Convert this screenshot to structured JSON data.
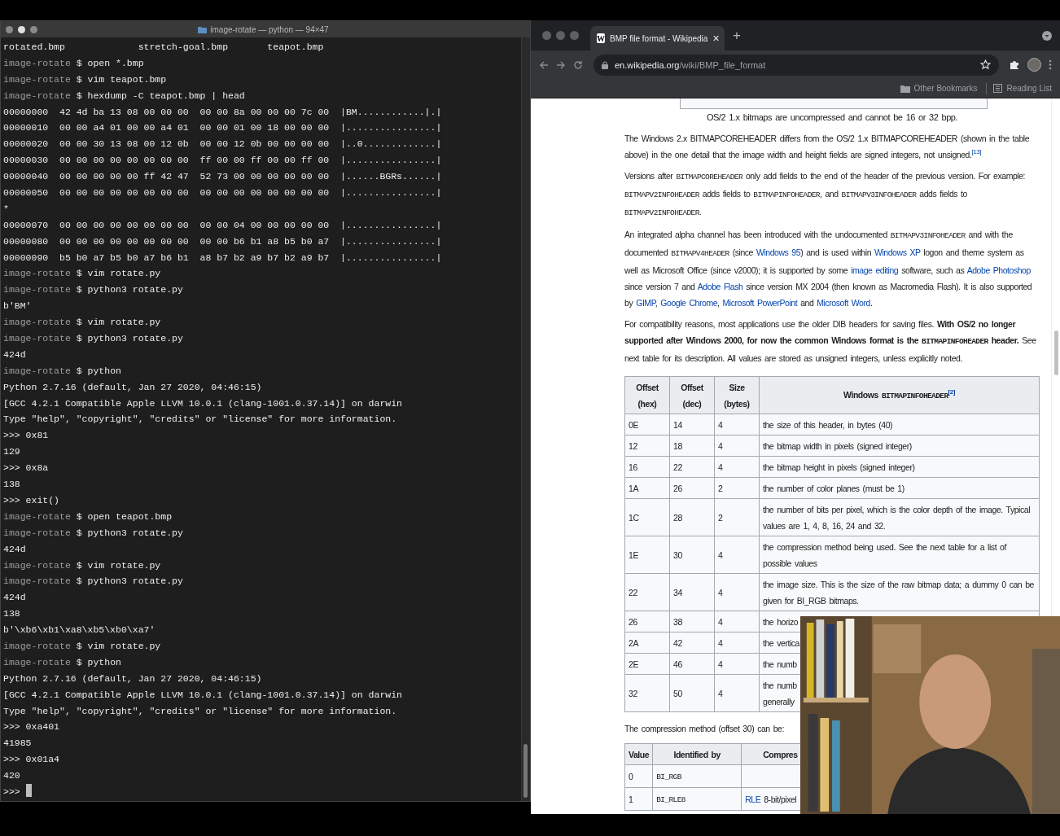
{
  "terminal": {
    "title": "image-rotate — python — 94×47",
    "lines": [
      {
        "text": "rotated.bmp             stretch-goal.bmp       teapot.bmp"
      },
      {
        "prompt": "image-rotate",
        "text": "$ open *.bmp"
      },
      {
        "prompt": "image-rotate",
        "text": "$ vim teapot.bmp"
      },
      {
        "prompt": "image-rotate",
        "text": "$ hexdump -C teapot.bmp | head"
      },
      {
        "text": "00000000  42 4d ba 13 08 00 00 00  00 00 8a 00 00 00 7c 00  |BM............|.|"
      },
      {
        "text": "00000010  00 00 a4 01 00 00 a4 01  00 00 01 00 18 00 00 00  |................|"
      },
      {
        "text": "00000020  00 00 30 13 08 00 12 0b  00 00 12 0b 00 00 00 00  |..0.............|"
      },
      {
        "text": "00000030  00 00 00 00 00 00 00 00  ff 00 00 ff 00 00 ff 00  |................|"
      },
      {
        "text": "00000040  00 00 00 00 00 ff 42 47  52 73 00 00 00 00 00 00  |......BGRs......|"
      },
      {
        "text": "00000050  00 00 00 00 00 00 00 00  00 00 00 00 00 00 00 00  |................|"
      },
      {
        "text": "*"
      },
      {
        "text": "00000070  00 00 00 00 00 00 00 00  00 00 04 00 00 00 00 00  |................|"
      },
      {
        "text": "00000080  00 00 00 00 00 00 00 00  00 00 b6 b1 a8 b5 b0 a7  |................|"
      },
      {
        "text": "00000090  b5 b0 a7 b5 b0 a7 b6 b1  a8 b7 b2 a9 b7 b2 a9 b7  |................|"
      },
      {
        "prompt": "image-rotate",
        "text": "$ vim rotate.py"
      },
      {
        "prompt": "image-rotate",
        "text": "$ python3 rotate.py"
      },
      {
        "text": "b'BM'"
      },
      {
        "prompt": "image-rotate",
        "text": "$ vim rotate.py"
      },
      {
        "prompt": "image-rotate",
        "text": "$ python3 rotate.py"
      },
      {
        "text": "424d"
      },
      {
        "prompt": "image-rotate",
        "text": "$ python"
      },
      {
        "text": "Python 2.7.16 (default, Jan 27 2020, 04:46:15)"
      },
      {
        "text": "[GCC 4.2.1 Compatible Apple LLVM 10.0.1 (clang-1001.0.37.14)] on darwin"
      },
      {
        "text": "Type \"help\", \"copyright\", \"credits\" or \"license\" for more information."
      },
      {
        "text": ">>> 0x81"
      },
      {
        "text": "129"
      },
      {
        "text": ">>> 0x8a"
      },
      {
        "text": "138"
      },
      {
        "text": ">>> exit()"
      },
      {
        "prompt": "image-rotate",
        "text": "$ open teapot.bmp"
      },
      {
        "prompt": "image-rotate",
        "text": "$ python3 rotate.py"
      },
      {
        "text": "424d"
      },
      {
        "prompt": "image-rotate",
        "text": "$ vim rotate.py"
      },
      {
        "prompt": "image-rotate",
        "text": "$ python3 rotate.py"
      },
      {
        "text": "424d"
      },
      {
        "text": "138"
      },
      {
        "text": "b'\\xb6\\xb1\\xa8\\xb5\\xb0\\xa7'"
      },
      {
        "prompt": "image-rotate",
        "text": "$ vim rotate.py"
      },
      {
        "prompt": "image-rotate",
        "text": "$ python"
      },
      {
        "text": "Python 2.7.16 (default, Jan 27 2020, 04:46:15)"
      },
      {
        "text": "[GCC 4.2.1 Compatible Apple LLVM 10.0.1 (clang-1001.0.37.14)] on darwin"
      },
      {
        "text": "Type \"help\", \"copyright\", \"credits\" or \"license\" for more information."
      },
      {
        "text": ">>> 0xa401"
      },
      {
        "text": "41985"
      },
      {
        "text": ">>> 0x01a4"
      },
      {
        "text": "420"
      },
      {
        "text": ">>>",
        "cursor": true
      }
    ]
  },
  "browser": {
    "tab": {
      "favicon": "W",
      "title": "BMP file format - Wikipedia",
      "close": "×"
    },
    "new_tab": "+",
    "url": {
      "domain": "en.wikipedia.org",
      "path": "/wiki/BMP_file_format"
    },
    "bookmarks": [
      "Other Bookmarks",
      "Reading List"
    ],
    "caption": "OS/2 1.x bitmaps are uncompressed and cannot be 16 or 32 bpp.",
    "paragraphs": [
      [
        {
          "kind": "plain",
          "text": "The Windows 2.x BITMAPCOREHEADER differs from the OS/2 1.x BITMAPCOREHEADER (shown in the table above) in the one detail that the image width and height fields are signed integers, not unsigned."
        },
        {
          "kind": "ref",
          "text": "[13]"
        }
      ],
      [
        {
          "kind": "plain",
          "text": "Versions after "
        },
        {
          "kind": "code",
          "text": "BITMAPCOREHEADER"
        },
        {
          "kind": "plain",
          "text": " only add fields to the end of the header of the previous version. For example: "
        },
        {
          "kind": "code",
          "text": "BITMAPV2INFOHEADER"
        },
        {
          "kind": "plain",
          "text": " adds fields to "
        },
        {
          "kind": "code",
          "text": "BITMAPINFOHEADER"
        },
        {
          "kind": "plain",
          "text": ", and "
        },
        {
          "kind": "code",
          "text": "BITMAPV3INFOHEADER"
        },
        {
          "kind": "plain",
          "text": " adds fields to "
        },
        {
          "kind": "code",
          "text": "BITMAPV2INFOHEADER"
        },
        {
          "kind": "plain",
          "text": "."
        }
      ],
      [
        {
          "kind": "plain",
          "text": "An integrated alpha channel has been introduced with the undocumented "
        },
        {
          "kind": "code",
          "text": "BITMAPV3INFOHEADER"
        },
        {
          "kind": "plain",
          "text": " and with the documented "
        },
        {
          "kind": "code",
          "text": "BITMAPV4HEADER"
        },
        {
          "kind": "plain",
          "text": " (since "
        },
        {
          "kind": "link",
          "text": "Windows 95"
        },
        {
          "kind": "plain",
          "text": ") and is used within "
        },
        {
          "kind": "link",
          "text": "Windows XP"
        },
        {
          "kind": "plain",
          "text": " logon and theme system as well as Microsoft Office (since v2000); it is supported by some "
        },
        {
          "kind": "link",
          "text": "image editing"
        },
        {
          "kind": "plain",
          "text": " software, such as "
        },
        {
          "kind": "link",
          "text": "Adobe Photoshop"
        },
        {
          "kind": "plain",
          "text": " since version 7 and "
        },
        {
          "kind": "link",
          "text": "Adobe Flash"
        },
        {
          "kind": "plain",
          "text": " since version MX 2004 (then known as Macromedia Flash). It is also supported by "
        },
        {
          "kind": "link",
          "text": "GIMP"
        },
        {
          "kind": "plain",
          "text": ", "
        },
        {
          "kind": "link",
          "text": "Google Chrome"
        },
        {
          "kind": "plain",
          "text": ", "
        },
        {
          "kind": "link",
          "text": "Microsoft PowerPoint"
        },
        {
          "kind": "plain",
          "text": " and "
        },
        {
          "kind": "link",
          "text": "Microsoft Word"
        },
        {
          "kind": "plain",
          "text": "."
        }
      ],
      [
        {
          "kind": "plain",
          "text": "For compatibility reasons, most applications use the older DIB headers for saving files. "
        },
        {
          "kind": "bold",
          "text": "With OS/2 no longer supported after Windows 2000, for now the common Windows format is the "
        },
        {
          "kind": "boldcode",
          "text": "BITMAPINFOHEADER"
        },
        {
          "kind": "bold",
          "text": " header."
        },
        {
          "kind": "plain",
          "text": " See next table for its description. All values are stored as unsigned integers, unless explicitly noted."
        }
      ]
    ],
    "header_table": {
      "columns": [
        {
          "label": "Offset (hex)"
        },
        {
          "label": "Offset (dec)"
        },
        {
          "label": "Size (bytes)"
        },
        {
          "label": "Windows ",
          "code": "BITMAPINFOHEADER",
          "ref": "[2]"
        }
      ],
      "rows": [
        [
          "0E",
          "14",
          "4",
          "the size of this header, in bytes (40)"
        ],
        [
          "12",
          "18",
          "4",
          "the bitmap width in pixels (signed integer)"
        ],
        [
          "16",
          "22",
          "4",
          "the bitmap height in pixels (signed integer)"
        ],
        [
          "1A",
          "26",
          "2",
          "the number of color planes (must be 1)"
        ],
        [
          "1C",
          "28",
          "2",
          "the number of bits per pixel, which is the color depth of the image. Typical values are 1, 4, 8, 16, 24 and 32."
        ],
        [
          "1E",
          "30",
          "4",
          "the compression method being used. See the next table for a list of possible values"
        ],
        [
          "22",
          "34",
          "4",
          "the image size. This is the size of the raw bitmap data; a dummy 0 can be given for BI_RGB bitmaps."
        ],
        [
          "26",
          "38",
          "4",
          "the horizo"
        ],
        [
          "2A",
          "42",
          "4",
          "the vertica"
        ],
        [
          "2E",
          "46",
          "4",
          "the numb"
        ],
        [
          "32",
          "50",
          "4",
          "the numb\ngenerally"
        ]
      ]
    },
    "compression_intro": "The compression method (offset 30) can be:",
    "compression_table": {
      "columns": [
        "Value",
        "Identified by",
        "Compres"
      ],
      "rows": [
        [
          {
            "kind": "plain",
            "text": "0"
          },
          {
            "kind": "code",
            "text": "BI_RGB"
          },
          {
            "kind": "empty",
            "text": ""
          }
        ],
        [
          {
            "kind": "plain",
            "text": "1"
          },
          {
            "kind": "code",
            "text": "BI_RLE8"
          },
          {
            "kind": "linked",
            "link": "RLE",
            "text": " 8-bit/pixel"
          }
        ]
      ]
    }
  }
}
